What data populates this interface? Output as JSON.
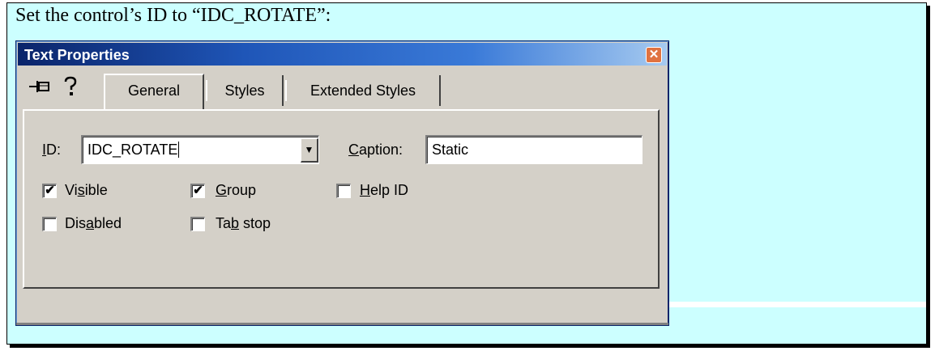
{
  "instruction": "Set the control’s ID to “IDC_ROTATE”:",
  "window": {
    "title": "Text Properties",
    "close_glyph": "✕"
  },
  "toolbar": {
    "pin_icon": "pin-icon",
    "help_icon": "help-icon",
    "pin_glyph": "⊣⌒",
    "help_glyph": "?"
  },
  "tabs": [
    {
      "label": "General",
      "active": true
    },
    {
      "label": "Styles",
      "active": false
    },
    {
      "label": "Extended Styles",
      "active": false
    }
  ],
  "fields": {
    "id_label_pre": "",
    "id_label_u": "I",
    "id_label_post": "D:",
    "id_value": "IDC_ROTATE",
    "caption_label_u": "C",
    "caption_label_post": "aption:",
    "caption_value": "Static"
  },
  "checkboxes": {
    "visible": {
      "pre": "Vi",
      "u": "s",
      "post": "ible",
      "checked": true
    },
    "group": {
      "pre": "",
      "u": "G",
      "post": "roup",
      "checked": true
    },
    "help_id": {
      "pre": "",
      "u": "H",
      "post": "elp ID",
      "checked": false
    },
    "disabled": {
      "pre": "Dis",
      "u": "a",
      "post": "bled",
      "checked": false
    },
    "tab_stop": {
      "pre": "Ta",
      "u": "b",
      "post": " stop",
      "checked": false
    }
  },
  "check_glyph": "✔",
  "colors": {
    "frame_bg": "#ccffff",
    "dialog_bg": "#d4d0c8",
    "title_bar": "#0a246a"
  }
}
